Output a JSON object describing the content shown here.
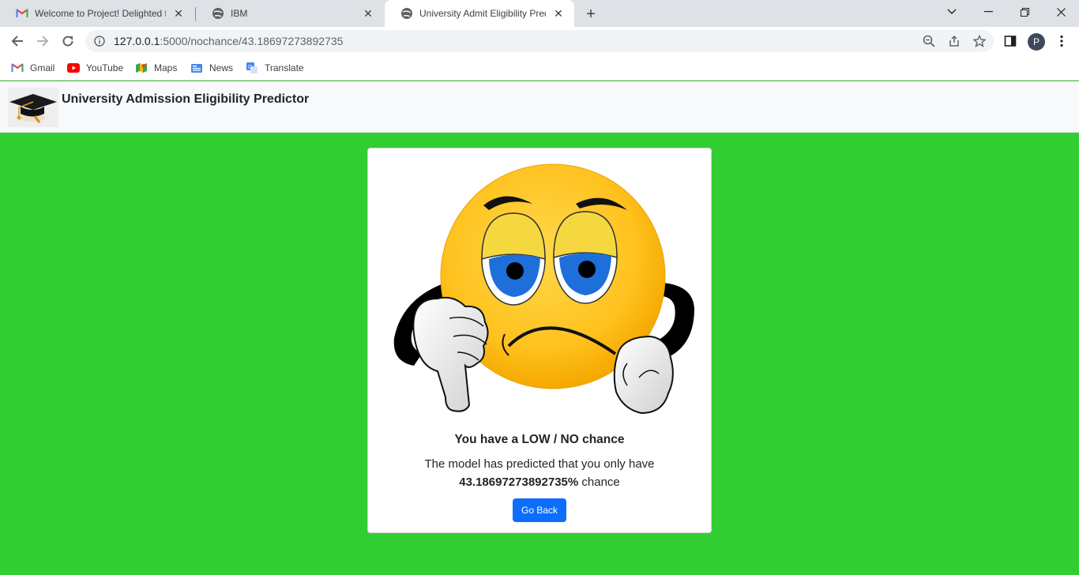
{
  "tabs": [
    {
      "title": "Welcome to Project! Delighted to",
      "icon": "gmail-icon"
    },
    {
      "title": "IBM",
      "icon": "globe-icon"
    },
    {
      "title": "University Admit Eligibility Predic",
      "icon": "globe-icon"
    }
  ],
  "address_bar": {
    "host": "127.0.0.1",
    "path": ":5000/nochance/43.18697273892735"
  },
  "profile_initial": "P",
  "bookmarks": [
    {
      "label": "Gmail",
      "icon": "gmail-icon"
    },
    {
      "label": "YouTube",
      "icon": "youtube-icon"
    },
    {
      "label": "Maps",
      "icon": "maps-icon"
    },
    {
      "label": "News",
      "icon": "news-icon"
    },
    {
      "label": "Translate",
      "icon": "translate-icon"
    }
  ],
  "navbar": {
    "title": "University Admission Eligibility Predictor"
  },
  "result": {
    "heading": "You have a LOW / NO chance",
    "text_before": "The model has predicted that you only have",
    "percentage": "43.18697273892735%",
    "text_after": "chance",
    "button_label": "Go Back"
  },
  "colors": {
    "page_bg": "#32cd32",
    "button": "#0d6efd",
    "navbar": "#f8f9fa"
  }
}
